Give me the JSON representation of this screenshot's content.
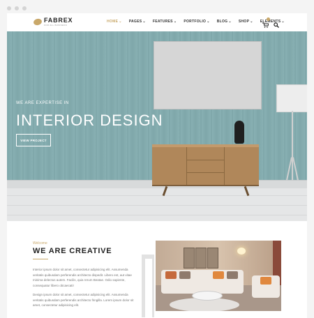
{
  "window": {
    "dots": 3
  },
  "brand": {
    "name": "FABREX",
    "tagline": "FOR ALL BUSINESS"
  },
  "nav": {
    "items": [
      {
        "label": "HOME",
        "active": true
      },
      {
        "label": "PAGES",
        "active": false
      },
      {
        "label": "FEATURES",
        "active": false
      },
      {
        "label": "PORTFOLIO",
        "active": false
      },
      {
        "label": "BLOG",
        "active": false
      },
      {
        "label": "SHOP",
        "active": false
      },
      {
        "label": "ELEMENTS",
        "active": false
      }
    ],
    "chevron": "⌄"
  },
  "hero": {
    "subtitle": "WE ARE EXPERTISE IN",
    "title": "INTERIOR DESIGN",
    "button": "VIEW PROJECT"
  },
  "about": {
    "eyebrow": "Welcome",
    "title": "WE ARE CREATIVE",
    "p1": "Interior ipsum dolor sit amet, consectetur adipisicing elit. Assumenda veritatis quibusdam perferendis architecto dispedit. Libero est, aut vitae minima delectus autem. Facilis, quia rerum Beatae. Odio sapiente, consequatur libero obcaecati!",
    "p2": "Design ipsum dolor sit amet, consectetur adipisicing elit. Assumenda veritatis quibusdam perferendis architecto fringilla. Lorem ipsum dolor sit amet, consectetur adipisicing elit."
  },
  "colors": {
    "accent": "#c9a86a",
    "wall": "#7fa7aa"
  }
}
